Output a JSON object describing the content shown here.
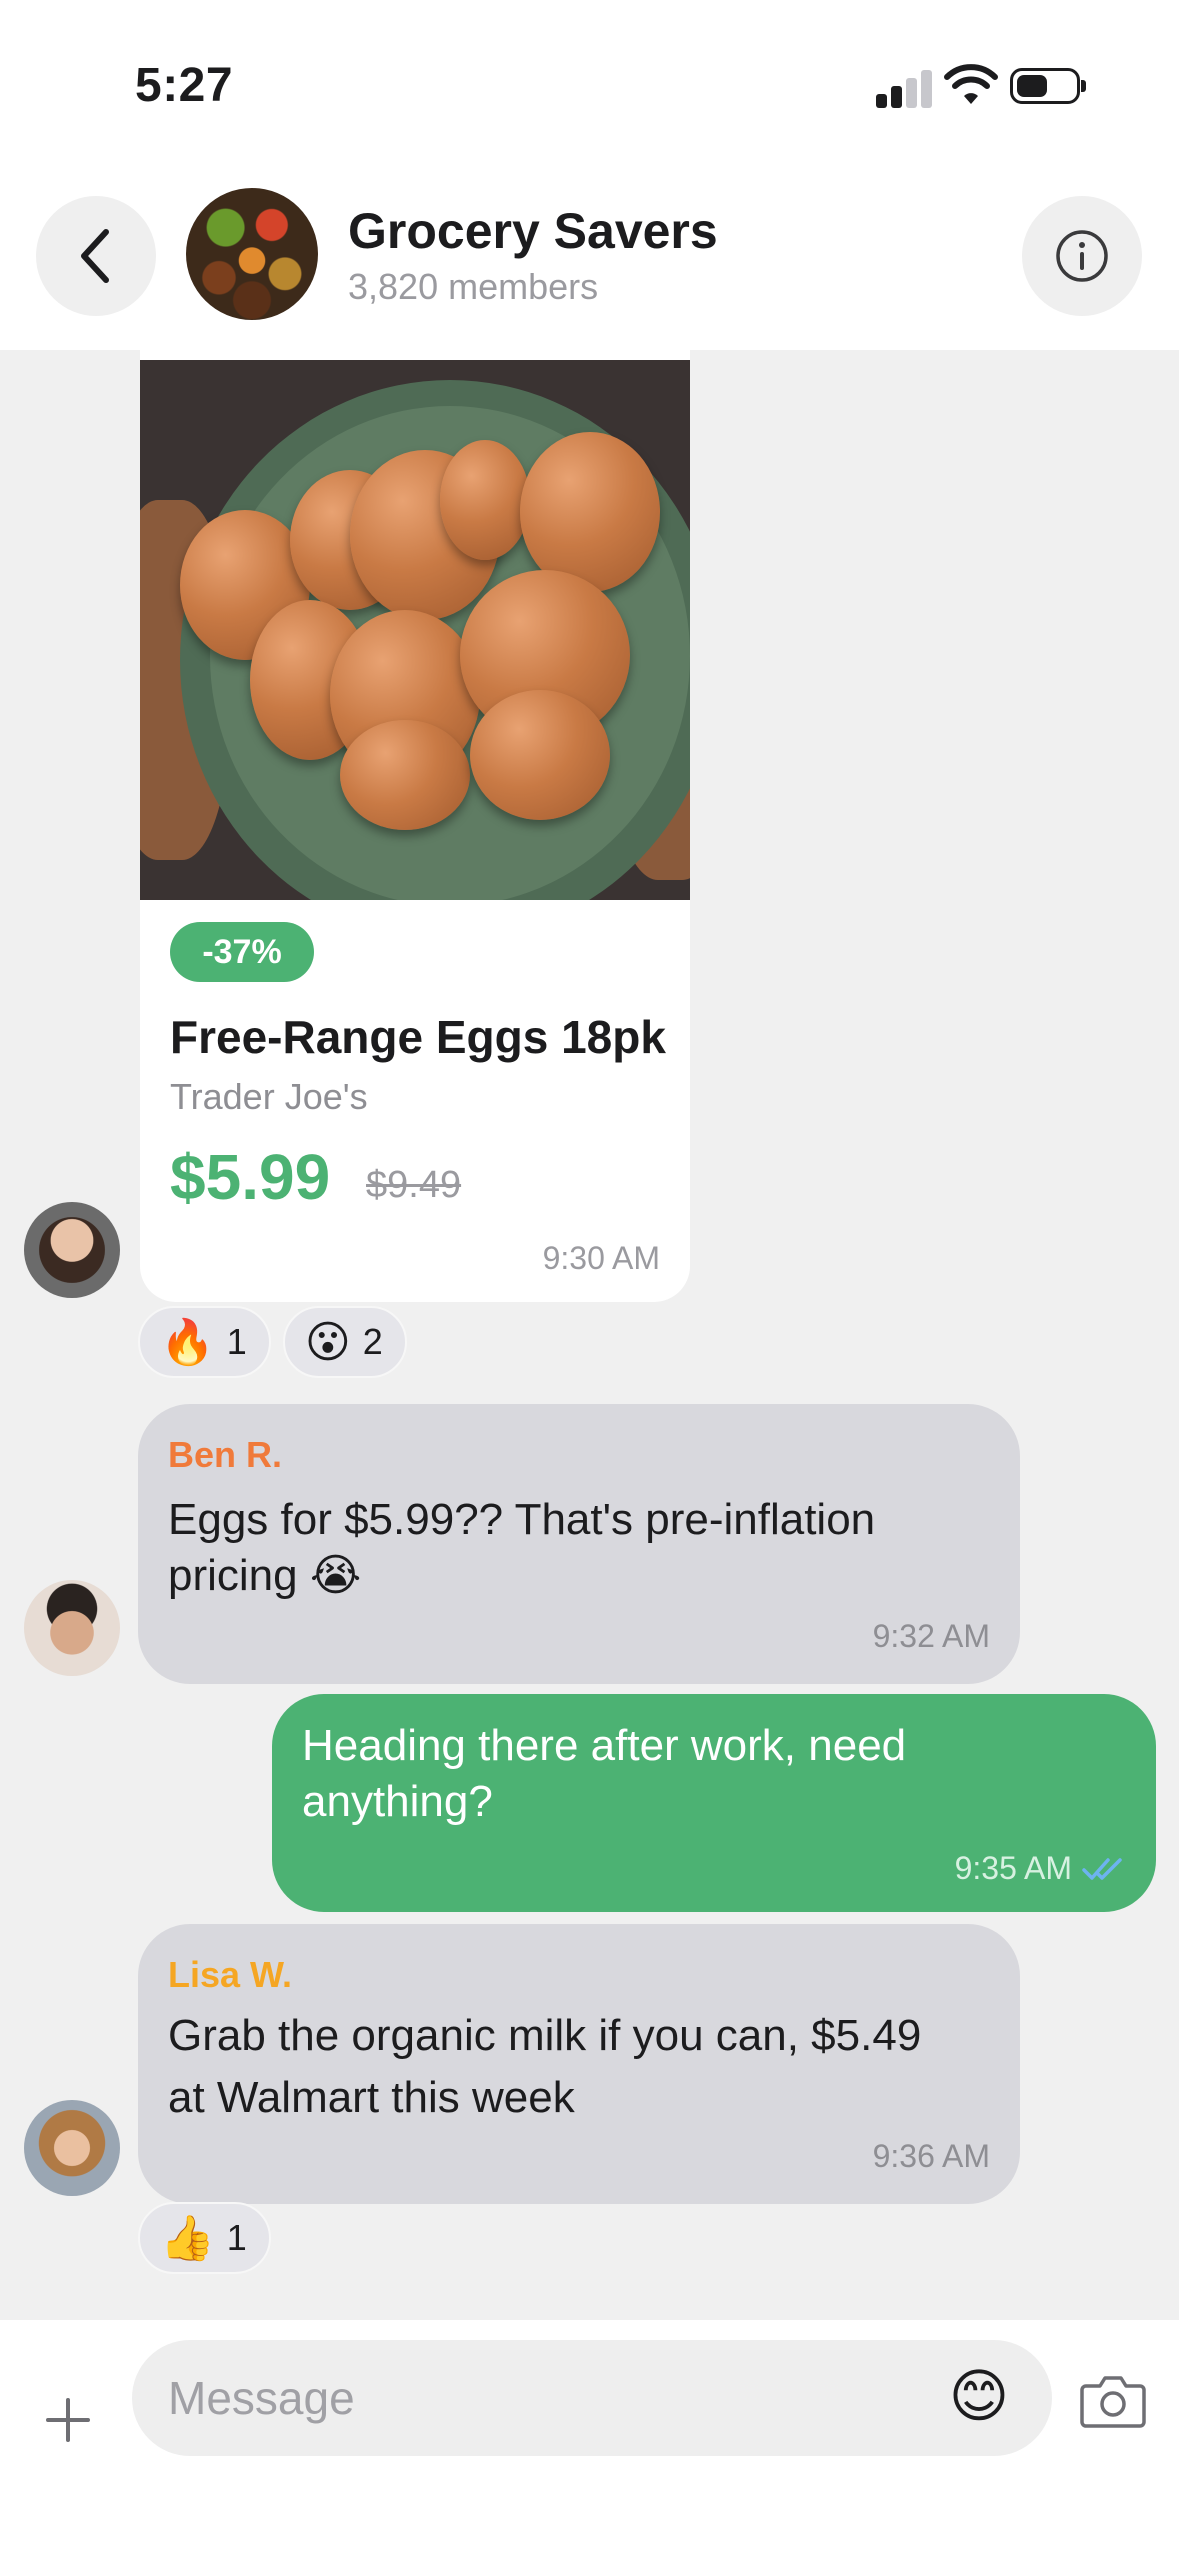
{
  "status_bar": {
    "time": "5:27"
  },
  "header": {
    "group_name": "Grocery Savers",
    "member_count": "3,820 members"
  },
  "deal_card": {
    "discount_badge": "-37%",
    "title": "Free-Range Eggs 18pk",
    "store": "Trader Joe's",
    "price": "$5.99",
    "original_price": "$9.49",
    "time": "9:30 AM",
    "reactions": [
      {
        "emoji": "🔥",
        "count": "1"
      },
      {
        "emoji": "😮",
        "count": "2"
      }
    ]
  },
  "messages": [
    {
      "sender": "Ben R.",
      "sender_color": "#f07a3a",
      "text_line1": "Eggs for $5.99?? That's pre-inflation",
      "text_line2": "pricing 😭",
      "time": "9:32 AM"
    },
    {
      "outgoing": true,
      "text_line1": "Heading there after work, need",
      "text_line2": "anything?",
      "time": "9:35 AM",
      "status": "read"
    },
    {
      "sender": "Lisa W.",
      "sender_color": "#f5a623",
      "text_line1": "Grab the organic milk if you can, $5.49",
      "text_line2": "at Walmart this week",
      "time": "9:36 AM",
      "reactions": [
        {
          "emoji": "👍",
          "count": "1"
        }
      ]
    }
  ],
  "composer": {
    "placeholder": "Message",
    "emoji": "😊"
  },
  "colors": {
    "accent_green": "#4cb273",
    "incoming_bubble": "#d8d8dd",
    "background": "#f0f0f0"
  },
  "icons": [
    "back-chevron-icon",
    "info-icon",
    "plus-icon",
    "emoji-icon",
    "camera-icon",
    "read-receipt-icon"
  ]
}
